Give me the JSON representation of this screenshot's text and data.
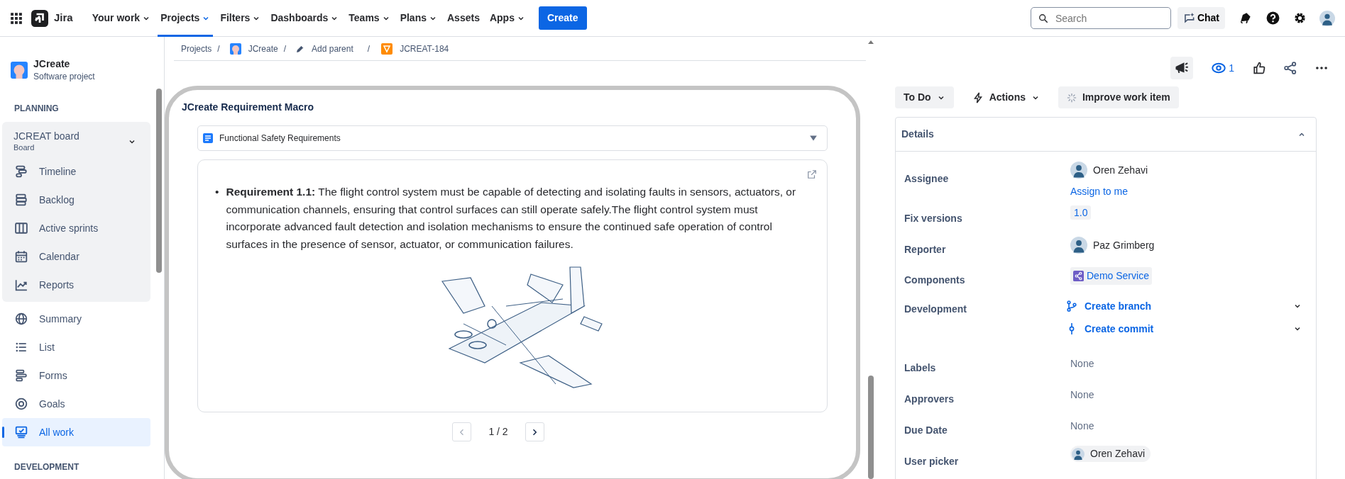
{
  "topnav": {
    "brand": "Jira",
    "items": [
      {
        "label": "Your work",
        "dropdown": true,
        "selected": false
      },
      {
        "label": "Projects",
        "dropdown": true,
        "selected": true
      },
      {
        "label": "Filters",
        "dropdown": true,
        "selected": false
      },
      {
        "label": "Dashboards",
        "dropdown": true,
        "selected": false
      },
      {
        "label": "Teams",
        "dropdown": true,
        "selected": false
      },
      {
        "label": "Plans",
        "dropdown": true,
        "selected": false
      },
      {
        "label": "Assets",
        "dropdown": false,
        "selected": false
      },
      {
        "label": "Apps",
        "dropdown": true,
        "selected": false
      }
    ],
    "create": "Create",
    "search": {
      "placeholder": "Search"
    },
    "chat": "Chat"
  },
  "sidebar": {
    "project_name": "JCreate",
    "project_type": "Software project",
    "planning_heading": "PLANNING",
    "board": {
      "name": "JCREAT board",
      "type": "Board",
      "expanded": true,
      "items": [
        {
          "label": "Timeline",
          "selected": false
        },
        {
          "label": "Backlog",
          "selected": false
        },
        {
          "label": "Active sprints",
          "selected": false
        },
        {
          "label": "Calendar",
          "selected": false
        },
        {
          "label": "Reports",
          "selected": false
        }
      ]
    },
    "items": [
      {
        "label": "Summary",
        "selected": false
      },
      {
        "label": "List",
        "selected": false
      },
      {
        "label": "Forms",
        "selected": false
      },
      {
        "label": "Goals",
        "selected": false
      },
      {
        "label": "All work",
        "selected": true
      }
    ],
    "development_heading": "DEVELOPMENT"
  },
  "breadcrumb": [
    {
      "kind": "text",
      "label": "Projects"
    },
    {
      "kind": "project",
      "label": "JCreate",
      "separator": "/"
    },
    {
      "kind": "parent",
      "label": "Add parent",
      "separator": "/"
    },
    {
      "kind": "issue",
      "label": "JCREAT-184",
      "separator": "/"
    }
  ],
  "macro": {
    "title": "JCreate Requirement Macro",
    "dropdown": {
      "label": "Functional Safety Requirements"
    },
    "bullet": "•",
    "requirement": "**Requirement 1.1:** The flight control system must be capable of detecting and isolating faults in sensors, actuators, or communication channels, ensuring that control surfaces can still operate safely.The flight control system must incorporate advanced fault detection and isolation mechanisms to ensure the continued safe operation of control surfaces in the presence of sensor, actuator, or communication failures.",
    "pager": {
      "text": "1 / 2",
      "prev_disabled": true,
      "next_disabled": false
    }
  },
  "issue_header": {
    "watchers": "1",
    "status": "To Do",
    "actions": "Actions",
    "improve": "Improve work item"
  },
  "details": {
    "title": "Details",
    "expanded": true,
    "fields": [
      {
        "label": "Assignee",
        "kind": "user",
        "value": "Oren Zehavi",
        "link": "Assign to me"
      },
      {
        "label": "Fix versions",
        "kind": "tag",
        "value": "1.0"
      },
      {
        "label": "Reporter",
        "kind": "user",
        "value": "Paz Grimberg"
      },
      {
        "label": "Components",
        "kind": "component",
        "value": "Demo Service"
      },
      {
        "label": "Development",
        "kind": "dev",
        "actions": [
          "Create branch",
          "Create commit"
        ]
      },
      {
        "label": "Labels",
        "kind": "empty",
        "value": "None"
      },
      {
        "label": "Approvers",
        "kind": "empty",
        "value": "None"
      },
      {
        "label": "Due Date",
        "kind": "empty",
        "value": "None"
      },
      {
        "label": "User picker",
        "kind": "chip",
        "value": "Oren Zehavi"
      }
    ]
  }
}
